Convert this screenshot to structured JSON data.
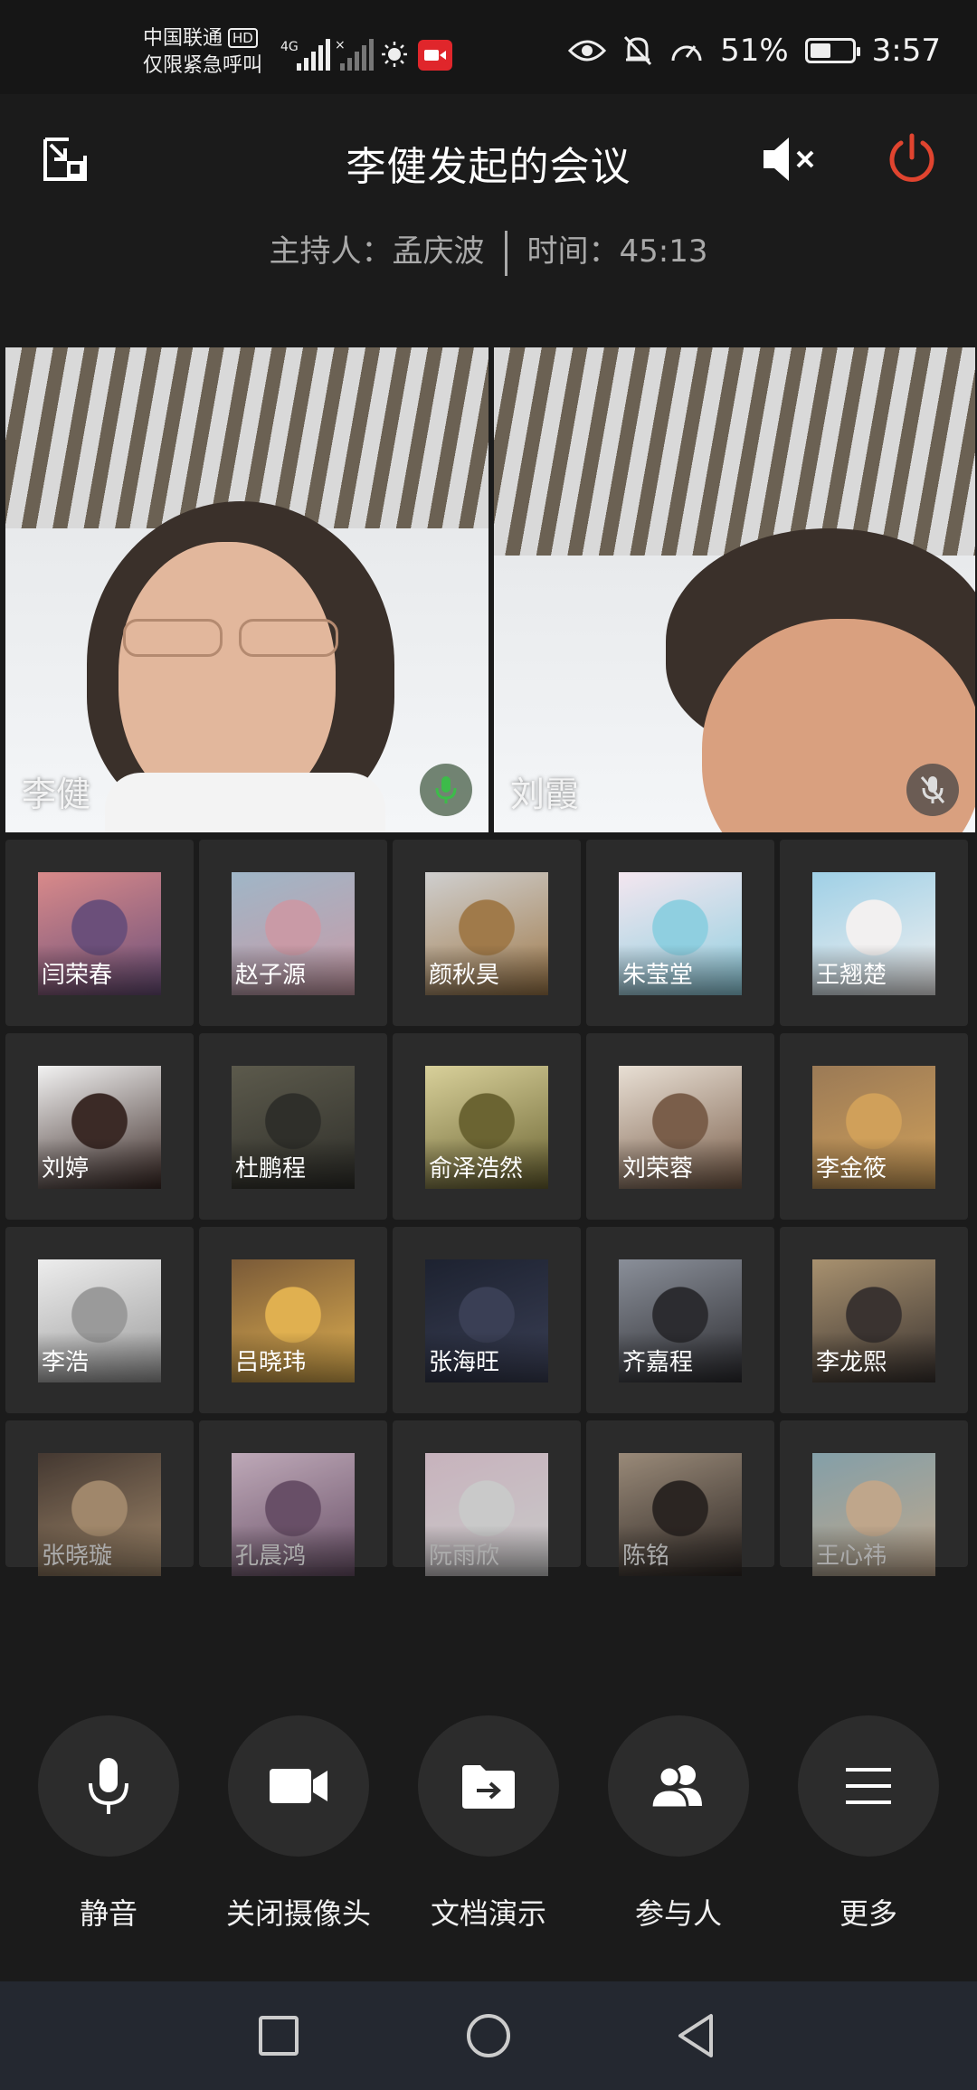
{
  "status_bar": {
    "carrier": "中国联通",
    "hd": "HD",
    "emergency": "仅限紧急呼叫",
    "network": "4G",
    "battery": "51%",
    "battery_level": 0.51,
    "time": "3:57"
  },
  "header": {
    "title": "李健发起的会议",
    "host_label": "主持人：孟庆波",
    "time_label": "时间：45:13"
  },
  "main_videos": [
    {
      "name": "李健"
    },
    {
      "name": "刘霞"
    }
  ],
  "participants": [
    {
      "name": "闫荣春"
    },
    {
      "name": "赵子源"
    },
    {
      "name": "颜秋昊"
    },
    {
      "name": "朱莹堂"
    },
    {
      "name": "王翘楚"
    },
    {
      "name": "刘婷"
    },
    {
      "name": "杜鹏程"
    },
    {
      "name": "俞泽浩然"
    },
    {
      "name": "刘荣蓉"
    },
    {
      "name": "李金筱"
    },
    {
      "name": "李浩"
    },
    {
      "name": "吕晓玮"
    },
    {
      "name": "张海旺"
    },
    {
      "name": "齐嘉程"
    },
    {
      "name": "李龙熙"
    },
    {
      "name": "张晓璇"
    },
    {
      "name": "孔晨鸿"
    },
    {
      "name": "阮雨欣"
    },
    {
      "name": "陈铭"
    },
    {
      "name": "王心祎"
    }
  ],
  "controls": [
    {
      "label": "静音",
      "icon": "microphone-icon"
    },
    {
      "label": "关闭摄像头",
      "icon": "camera-icon"
    },
    {
      "label": "文档演示",
      "icon": "document-share-icon"
    },
    {
      "label": "参与人",
      "icon": "participants-icon"
    },
    {
      "label": "更多",
      "icon": "menu-icon"
    }
  ],
  "nav": [
    "recents-icon",
    "home-icon",
    "back-icon"
  ],
  "colors": {
    "background": "#1b1b1b",
    "power_red": "#e0442f",
    "recording_red": "#e0262b",
    "tile": "#2b2b2b"
  }
}
